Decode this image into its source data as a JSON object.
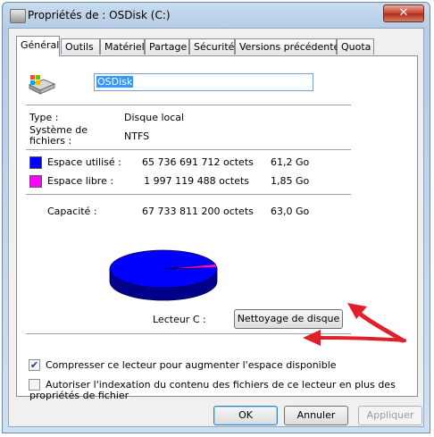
{
  "window": {
    "title": "Propriétés de : OSDisk (C:)",
    "close_glyph": "✕"
  },
  "tabs": [
    {
      "label": "Général"
    },
    {
      "label": "Outils"
    },
    {
      "label": "Matériel"
    },
    {
      "label": "Partage"
    },
    {
      "label": "Sécurité"
    },
    {
      "label": "Versions précédentes"
    },
    {
      "label": "Quota"
    }
  ],
  "drive": {
    "name": "OSDisk"
  },
  "info": {
    "type_label": "Type :",
    "type_value": "Disque local",
    "fs_label_line1": "Système de",
    "fs_label_line2": "fichiers :",
    "fs_value": "NTFS"
  },
  "usage": {
    "used_label": "Espace utilisé :",
    "used_bytes": "65 736 691 712 octets",
    "used_size": "61,2 Go",
    "used_color": "#0000ff",
    "free_label": "Espace libre :",
    "free_bytes": "1 997 119 488 octets",
    "free_size": "1,85 Go",
    "free_color": "#ff00ff",
    "capacity_label": "Capacité :",
    "capacity_bytes": "67 733 811 200 octets",
    "capacity_size": "63,0 Go",
    "drive_label": "Lecteur C :",
    "free_fraction": 0.0295,
    "cleanup_button": "Nettoyage de disque"
  },
  "options": {
    "compress_label": "Compresser ce lecteur pour augmenter l'espace disponible",
    "compress_checked": true,
    "index_label_line1": "Autoriser l'indexation du contenu des fichiers de ce lecteur en plus des",
    "index_label_line2": "propriétés de fichier",
    "index_checked": false
  },
  "footer": {
    "ok": "OK",
    "cancel": "Annuler",
    "apply": "Appliquer"
  },
  "annotation_color": "#e0202a"
}
